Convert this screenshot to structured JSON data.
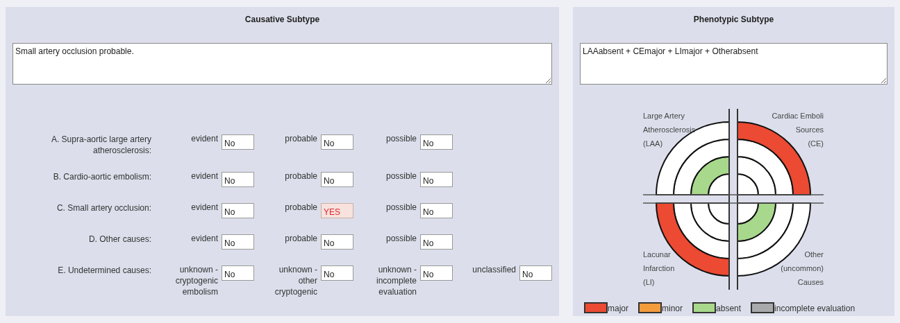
{
  "causative": {
    "title": "Causative Subtype",
    "summary": "Small artery occlusion probable.",
    "rows": [
      {
        "label": "A. Supra-aortic large artery atherosclerosis:",
        "fields": [
          {
            "label": "evident",
            "value": "No",
            "flagged": false
          },
          {
            "label": "probable",
            "value": "No",
            "flagged": false
          },
          {
            "label": "possible",
            "value": "No",
            "flagged": false
          }
        ]
      },
      {
        "label": "B. Cardio-aortic embolism:",
        "fields": [
          {
            "label": "evident",
            "value": "No",
            "flagged": false
          },
          {
            "label": "probable",
            "value": "No",
            "flagged": false
          },
          {
            "label": "possible",
            "value": "No",
            "flagged": false
          }
        ]
      },
      {
        "label": "C. Small artery occlusion:",
        "fields": [
          {
            "label": "evident",
            "value": "No",
            "flagged": false
          },
          {
            "label": "probable",
            "value": "YES",
            "flagged": true
          },
          {
            "label": "possible",
            "value": "No",
            "flagged": false
          }
        ]
      },
      {
        "label": "D. Other causes:",
        "fields": [
          {
            "label": "evident",
            "value": "No",
            "flagged": false
          },
          {
            "label": "probable",
            "value": "No",
            "flagged": false
          },
          {
            "label": "possible",
            "value": "No",
            "flagged": false
          }
        ]
      },
      {
        "label": "E. Undetermined causes:",
        "fields": [
          {
            "label": "unknown - cryptogenic embolism",
            "value": "No",
            "flagged": false
          },
          {
            "label": "unknown - other cryptogenic",
            "value": "No",
            "flagged": false
          },
          {
            "label": "unknown - incomplete evaluation",
            "value": "No",
            "flagged": false
          },
          {
            "label": "unclassified",
            "value": "No",
            "flagged": false
          }
        ]
      }
    ]
  },
  "phenotypic": {
    "title": "Phenotypic Subtype",
    "summary": "LAAabsent + CEmajor + LImajor + Otherabsent",
    "diagram": {
      "quadrants": [
        {
          "label_lines": [
            "Large Artery",
            "Atherosclerosis",
            "(LAA)"
          ],
          "kind": "absent"
        },
        {
          "label_lines": [
            "Cardiac Emboli",
            "Sources",
            "(CE)"
          ],
          "kind": "major"
        },
        {
          "label_lines": [
            "Lacunar",
            "Infarction",
            "(LI)"
          ],
          "kind": "major"
        },
        {
          "label_lines": [
            "Other",
            "(uncommon)",
            "Causes"
          ],
          "kind": "absent"
        }
      ]
    },
    "legend": [
      {
        "label": "major",
        "color": "#ec4a32"
      },
      {
        "label": "minor",
        "color": "#f49b3c"
      },
      {
        "label": "absent",
        "color": "#a8d88c"
      },
      {
        "label": "incomplete evaluation",
        "color": "#a8aaac"
      }
    ]
  }
}
